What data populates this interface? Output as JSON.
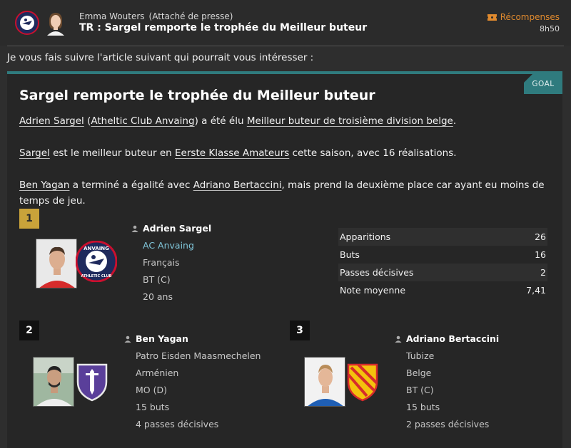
{
  "header": {
    "sender_name": "Emma Wouters",
    "sender_role": "(Attaché de presse)",
    "subject": "TR : Sargel remporte le trophée du Meilleur buteur",
    "rewards_label": "Récompenses",
    "time": "8h50"
  },
  "intro": "Je vous fais suivre l'article suivant qui pourrait vous intéresser :",
  "article": {
    "tag": "GOAL",
    "title": "Sargel remporte le trophée du Meilleur buteur",
    "p1": {
      "player": "Adrien Sargel",
      "club": "Atheltic Club Anvaing",
      "mid": " a été élu ",
      "award": "Meilleur buteur de troisième division belge",
      "end": "."
    },
    "p2": {
      "player": "Sargel",
      "mid": " est le meilleur buteur en ",
      "league": "Eerste Klasse Amateurs",
      "end": " cette saison, avec 16 réalisations."
    },
    "p3": {
      "player1": "Ben Yagan",
      "mid": " a terminé a égalité avec ",
      "player2": "Adriano Bertaccini",
      "end": ", mais prend la deuxième place car ayant eu moins de temps de jeu."
    }
  },
  "winners": [
    {
      "rank": "1",
      "name": "Adrien Sargel",
      "club": "AC Anvaing",
      "nationality": "Français",
      "position": "BT (C)",
      "age": "20 ans"
    },
    {
      "rank": "2",
      "name": "Ben Yagan",
      "club": "Patro Eisden Maasmechelen",
      "nationality": "Arménien",
      "position": "MO (D)",
      "goals": "15 buts",
      "assists": "4 passes décisives"
    },
    {
      "rank": "3",
      "name": "Adriano Bertaccini",
      "club": "Tubize",
      "nationality": "Belge",
      "position": "BT (C)",
      "goals": "15 buts",
      "assists": "2 passes décisives"
    }
  ],
  "stats": [
    {
      "label": "Apparitions",
      "value": "26"
    },
    {
      "label": "Buts",
      "value": "16"
    },
    {
      "label": "Passes décisives",
      "value": "2"
    },
    {
      "label": "Note moyenne",
      "value": "7,41"
    }
  ],
  "badge_text": {
    "anvaing_top": "ANVAING",
    "anvaing_bottom": "ATHLETIC CLUB"
  },
  "colors": {
    "accent": "#2f7b7e",
    "gold": "#c9a33a",
    "rewards": "#e08a2e",
    "link": "#7fc4d8"
  }
}
